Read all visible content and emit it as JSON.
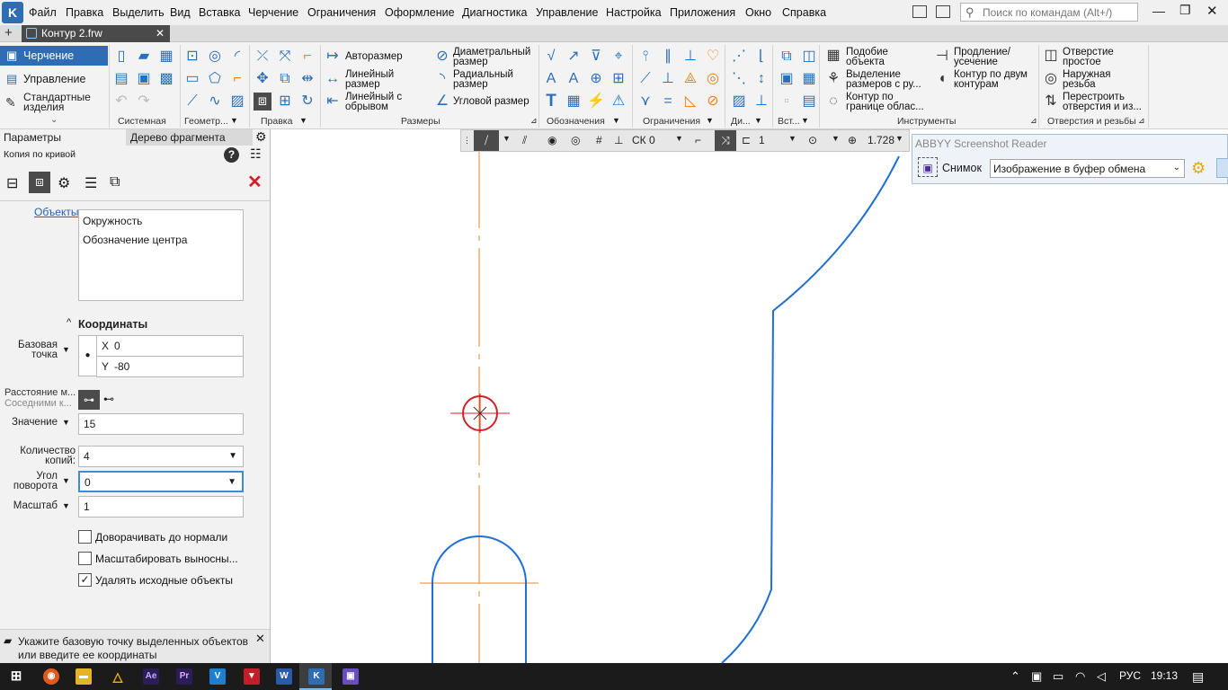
{
  "menu": {
    "items": [
      "Файл",
      "Правка",
      "Выделить",
      "Вид",
      "Вставка",
      "Черчение",
      "Ограничения",
      "Оформление",
      "Диагностика",
      "Управление",
      "Настройка",
      "Приложения",
      "Окно",
      "Справка"
    ],
    "search_placeholder": "Поиск по командам (Alt+/)"
  },
  "tab": {
    "title": "Контур 2.frw"
  },
  "ribbon": {
    "modes": [
      "Черчение",
      "Управление",
      "Стандартные изделия"
    ],
    "groups": [
      "Системная",
      "Геометр...",
      "Правка",
      "Размеры",
      "Обозначения",
      "Ограничения",
      "Ди...",
      "Вст...",
      "Инструменты",
      "Отверстия и резьбы"
    ],
    "dimensions": [
      "Авторазмер",
      "Линейный размер",
      "Линейный с обрывом",
      "Диаметральный размер",
      "Радиальный размер",
      "Угловой размер"
    ],
    "tools": [
      "Подобие объекта",
      "Выделение размеров с ру...",
      "Контур по границе облас...",
      "Продление/усечение",
      "Контур по двум контурам"
    ],
    "holes": [
      "Отверстие простое",
      "Наружная резьба",
      "Перестроить отверстия и из..."
    ]
  },
  "panel": {
    "tabs": [
      "Параметры",
      "Дерево фрагмента"
    ],
    "command": "Копия по кривой",
    "objects_label": "Объекты",
    "objects": [
      "Окружность",
      "Обозначение центра"
    ],
    "coords_header": "Координаты",
    "base_point_label": "Базовая точка",
    "x_label": "X",
    "x_value": "0",
    "y_label": "Y",
    "y_value": "-80",
    "distance_label": "Расстояние м...",
    "neighbors_label": "Соседними к...",
    "value_label": "Значение",
    "value": "15",
    "count_label": "Количество копий:",
    "count": "4",
    "angle_label": "Угол поворота",
    "angle": "0",
    "scale_label": "Масштаб",
    "scale": "1",
    "checkboxes": [
      {
        "label": "Доворачивать до нормали",
        "checked": false
      },
      {
        "label": "Масштабировать выносны...",
        "checked": false
      },
      {
        "label": "Удалять исходные объекты",
        "checked": true
      }
    ],
    "hint": "Укажите базовую точку выделенных объектов или введите ее координаты"
  },
  "viewbar": {
    "cs": "СК 0",
    "layer": "1",
    "zoom": "1.728"
  },
  "abbyy": {
    "title": "ABBYY Screenshot Reader",
    "snap_label": "Снимок",
    "target": "Изображение в буфер обмена"
  },
  "taskbar": {
    "lang": "РУС",
    "time": "19:13"
  },
  "colors": {
    "accent": "#2e6db4",
    "contour": "#1f6fd6",
    "axis": "#e08a2e",
    "selection": "#d0202a"
  }
}
